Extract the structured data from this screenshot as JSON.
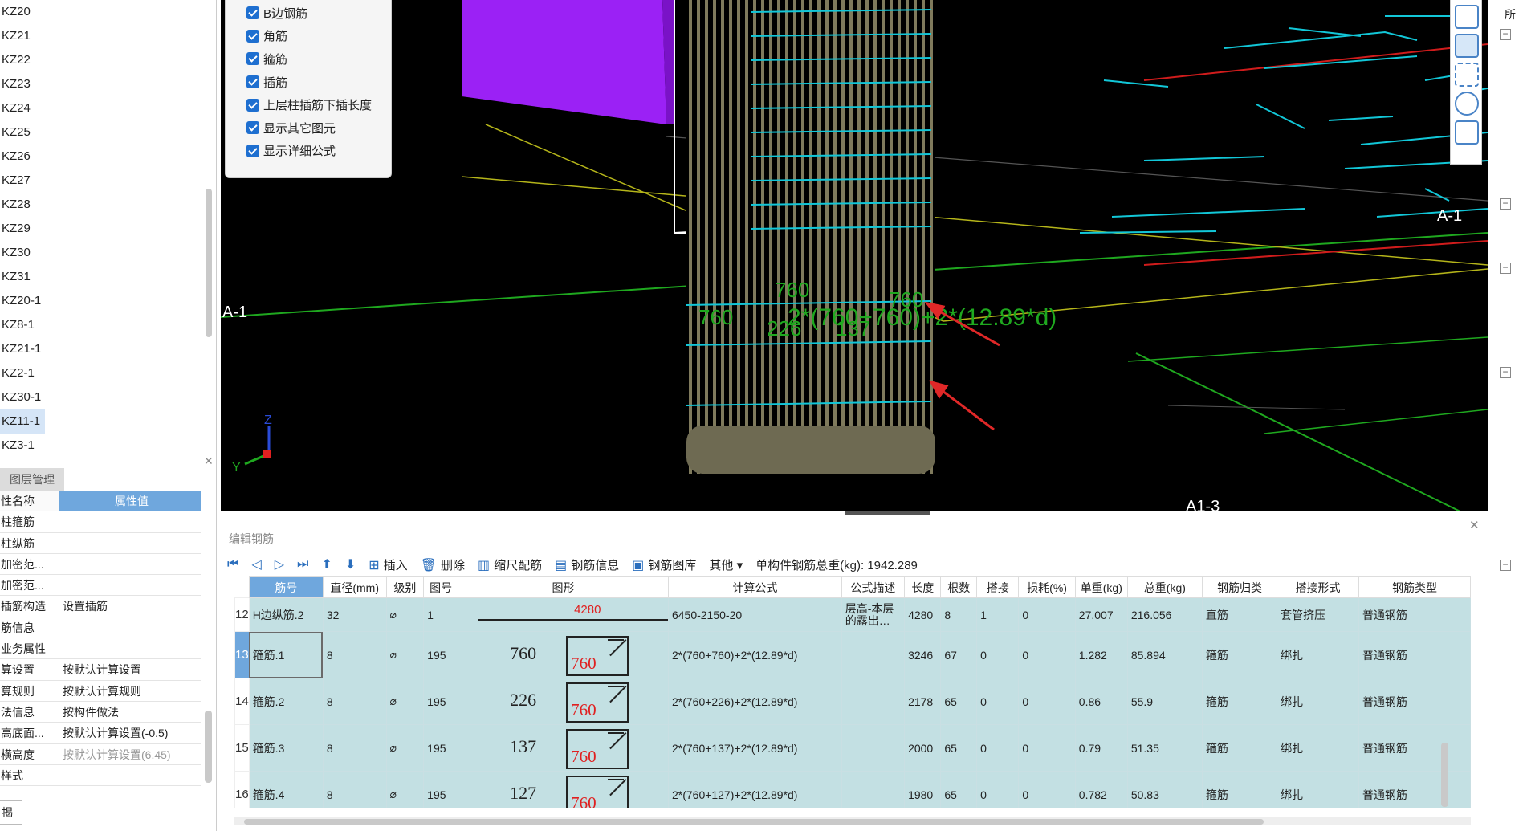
{
  "component_list": [
    "KZ20",
    "KZ21",
    "KZ22",
    "KZ23",
    "KZ24",
    "KZ25",
    "KZ26",
    "KZ27",
    "KZ28",
    "KZ29",
    "KZ30",
    "KZ31",
    "KZ20-1",
    "KZ8-1",
    "KZ21-1",
    "KZ2-1",
    "KZ30-1",
    "KZ11-1",
    "KZ3-1"
  ],
  "component_selected": "KZ11-1",
  "layer_panel_title": "图层管理",
  "properties": {
    "header_key": "性名称",
    "header_value": "属性值",
    "rows": [
      {
        "k": "柱箍筋",
        "v": ""
      },
      {
        "k": "柱纵筋",
        "v": ""
      },
      {
        "k": "加密范...",
        "v": ""
      },
      {
        "k": "加密范...",
        "v": ""
      },
      {
        "k": "插筋构造",
        "v": "设置插筋"
      },
      {
        "k": "筋信息",
        "v": ""
      },
      {
        "k": "业务属性",
        "v": ""
      },
      {
        "k": "算设置",
        "v": "按默认计算设置"
      },
      {
        "k": "算规则",
        "v": "按默认计算规则"
      },
      {
        "k": "法信息",
        "v": "按构件做法"
      },
      {
        "k": "高底面...",
        "v": "按默认计算设置(-0.5)"
      },
      {
        "k": "横高度",
        "v": "按默认计算设置(6.45)"
      },
      {
        "k": "样式",
        "v": ""
      }
    ],
    "bottom_button": "揭"
  },
  "display_options": [
    "B边钢筋",
    "角筋",
    "箍筋",
    "插筋",
    "上层柱插筋下插长度",
    "显示其它图元",
    "显示详细公式"
  ],
  "viewport": {
    "axis_labels": [
      "A-1",
      "A-1",
      "A1-3"
    ],
    "dim_texts": [
      "760",
      "760",
      "760",
      "226",
      "137",
      "2*(760+760)+2*(12.89*d)"
    ],
    "axis_x": "X",
    "axis_y": "Y",
    "axis_z": "Z"
  },
  "editor": {
    "title": "编辑钢筋",
    "toolbar": {
      "insert": "插入",
      "delete": "删除",
      "scale": "缩尺配筋",
      "info": "钢筋信息",
      "library": "钢筋图库",
      "other": "其他",
      "total_label": "单构件钢筋总重(kg):",
      "total_value": "1942.289"
    },
    "columns": [
      "筋号",
      "直径(mm)",
      "级别",
      "图号",
      "图形",
      "计算公式",
      "公式描述",
      "长度",
      "根数",
      "搭接",
      "损耗(%)",
      "单重(kg)",
      "总重(kg)",
      "钢筋归类",
      "搭接形式",
      "钢筋类型"
    ],
    "rows": [
      {
        "n": "12",
        "name": "H边纵筋.2",
        "d": "32",
        "grade": "⌀",
        "fig": "1",
        "shape_a": "",
        "shape_b": "4280",
        "formula": "6450-2150-20",
        "desc": "层高-本层的露出…",
        "len": "4280",
        "cnt": "8",
        "lap": "1",
        "loss": "0",
        "unit": "27.007",
        "total": "216.056",
        "cls": "直筋",
        "lapform": "套管挤压",
        "type": "普通钢筋"
      },
      {
        "n": "13",
        "name": "箍筋.1",
        "d": "8",
        "grade": "⌀",
        "fig": "195",
        "shape_a": "760",
        "shape_b": "760",
        "formula": "2*(760+760)+2*(12.89*d)",
        "desc": "",
        "len": "3246",
        "cnt": "67",
        "lap": "0",
        "loss": "0",
        "unit": "1.282",
        "total": "85.894",
        "cls": "箍筋",
        "lapform": "绑扎",
        "type": "普通钢筋"
      },
      {
        "n": "14",
        "name": "箍筋.2",
        "d": "8",
        "grade": "⌀",
        "fig": "195",
        "shape_a": "226",
        "shape_b": "760",
        "formula": "2*(760+226)+2*(12.89*d)",
        "desc": "",
        "len": "2178",
        "cnt": "65",
        "lap": "0",
        "loss": "0",
        "unit": "0.86",
        "total": "55.9",
        "cls": "箍筋",
        "lapform": "绑扎",
        "type": "普通钢筋"
      },
      {
        "n": "15",
        "name": "箍筋.3",
        "d": "8",
        "grade": "⌀",
        "fig": "195",
        "shape_a": "137",
        "shape_b": "760",
        "formula": "2*(760+137)+2*(12.89*d)",
        "desc": "",
        "len": "2000",
        "cnt": "65",
        "lap": "0",
        "loss": "0",
        "unit": "0.79",
        "total": "51.35",
        "cls": "箍筋",
        "lapform": "绑扎",
        "type": "普通钢筋"
      },
      {
        "n": "16",
        "name": "箍筋.4",
        "d": "8",
        "grade": "⌀",
        "fig": "195",
        "shape_a": "127",
        "shape_b": "760",
        "formula": "2*(760+127)+2*(12.89*d)",
        "desc": "",
        "len": "1980",
        "cnt": "65",
        "lap": "0",
        "loss": "0",
        "unit": "0.782",
        "total": "50.83",
        "cls": "箍筋",
        "lapform": "绑扎",
        "type": "普通钢筋"
      }
    ]
  },
  "right_panel_top": "所"
}
